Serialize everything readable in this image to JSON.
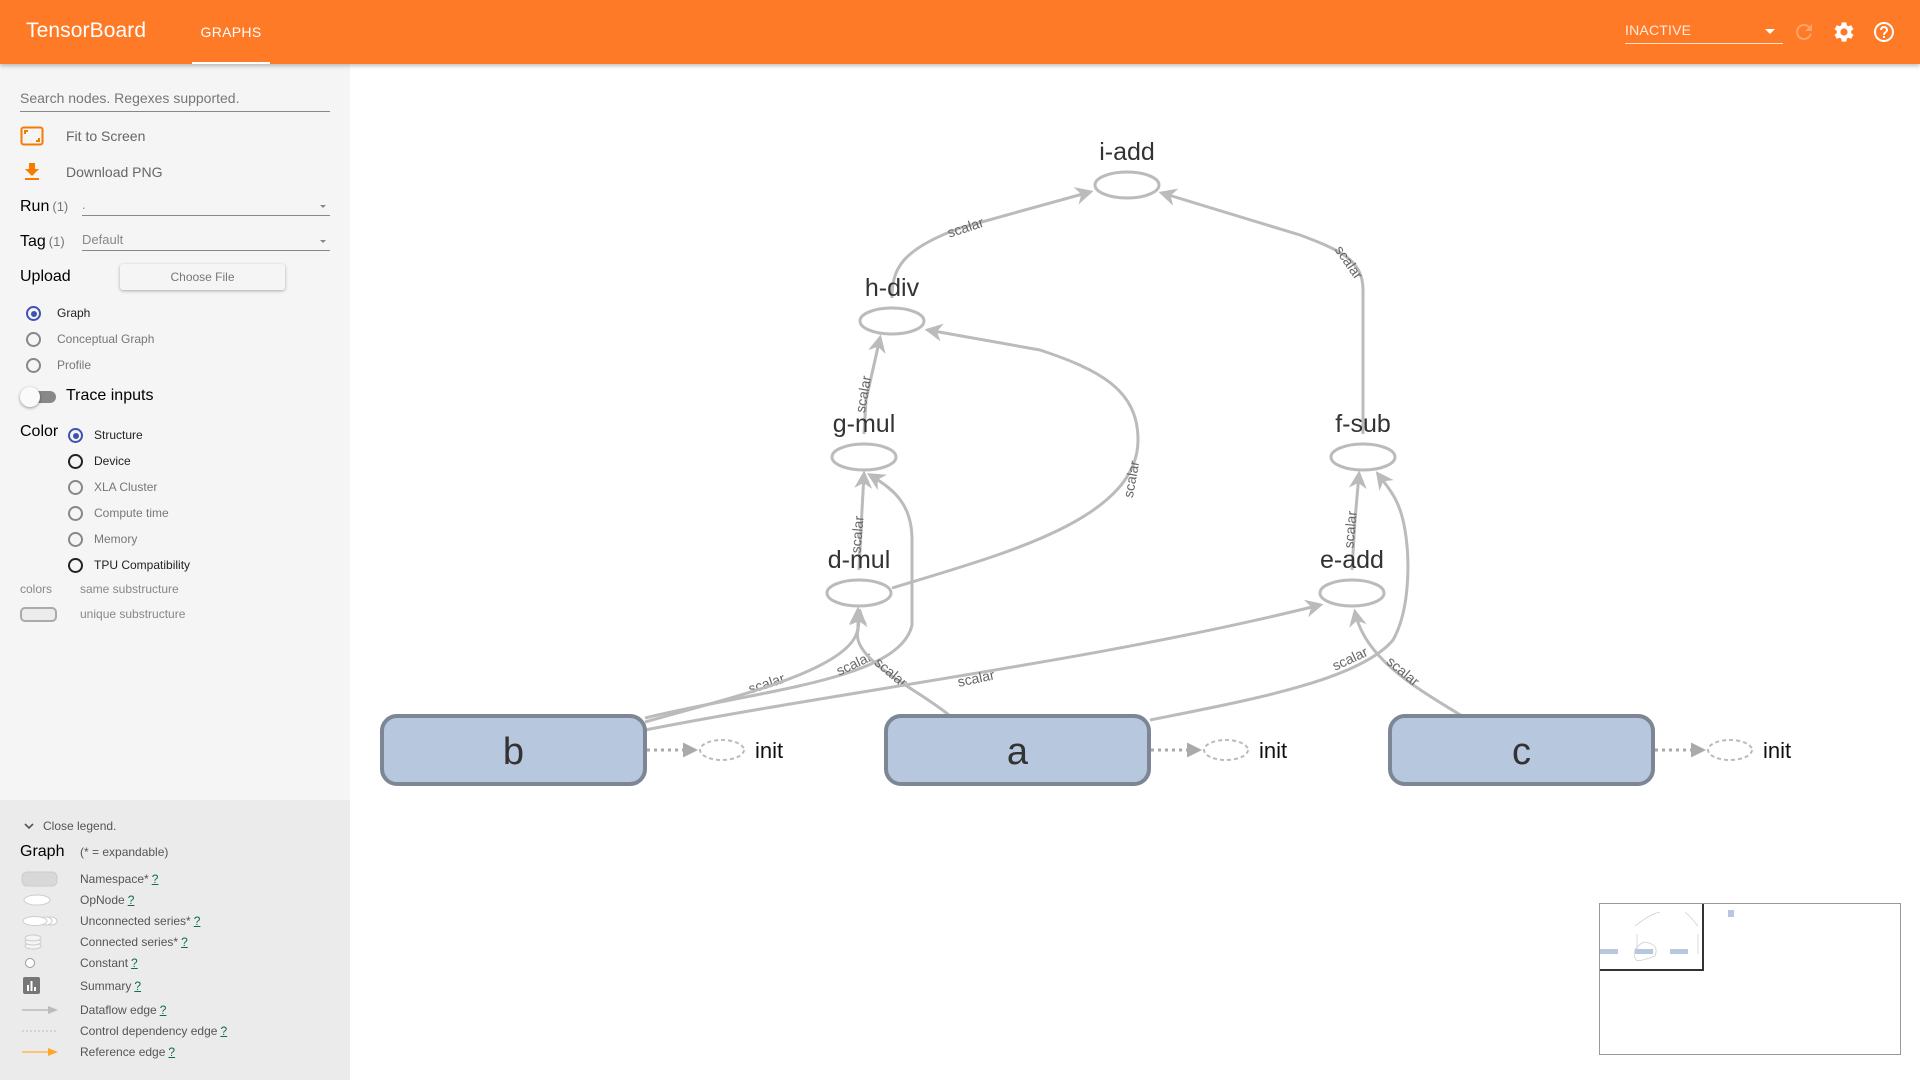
{
  "header": {
    "brand": "TensorBoard",
    "tabs": [
      {
        "label": "GRAPHS",
        "active": true
      }
    ],
    "run_status": "INACTIVE",
    "icons": [
      "refresh-icon",
      "settings-icon",
      "help-icon"
    ],
    "accent_color": "#ff7a26"
  },
  "sidebar": {
    "search_placeholder": "Search nodes. Regexes supported.",
    "actions": [
      {
        "label": "Fit to Screen",
        "icon": "fit-screen-icon"
      },
      {
        "label": "Download PNG",
        "icon": "download-icon"
      }
    ],
    "run": {
      "label": "Run",
      "count": "(1)",
      "value": "."
    },
    "tag": {
      "label": "Tag",
      "count": "(1)",
      "value": "Default"
    },
    "upload": {
      "label": "Upload",
      "button": "Choose File"
    },
    "graph_types": [
      {
        "label": "Graph",
        "selected": true
      },
      {
        "label": "Conceptual Graph",
        "selected": false
      },
      {
        "label": "Profile",
        "selected": false
      }
    ],
    "trace_inputs": {
      "label": "Trace inputs",
      "enabled": false
    },
    "color": {
      "label": "Color",
      "options": [
        {
          "label": "Structure",
          "selected": true
        },
        {
          "label": "Device",
          "selected": false
        },
        {
          "label": "XLA Cluster",
          "selected": false
        },
        {
          "label": "Compute time",
          "selected": false
        },
        {
          "label": "Memory",
          "selected": false
        },
        {
          "label": "TPU Compatibility",
          "selected": false
        }
      ]
    },
    "colors_legend": {
      "label": "colors",
      "same": "same substructure",
      "unique": "unique substructure"
    }
  },
  "legend": {
    "close": "Close legend.",
    "title": "Graph",
    "subtitle": "(* = expandable)",
    "items": [
      {
        "label": "Namespace*",
        "help": "?"
      },
      {
        "label": "OpNode",
        "help": "?"
      },
      {
        "label": "Unconnected series*",
        "help": "?"
      },
      {
        "label": "Connected series*",
        "help": "?"
      },
      {
        "label": "Constant",
        "help": "?"
      },
      {
        "label": "Summary",
        "help": "?"
      },
      {
        "label": "Dataflow edge",
        "help": "?"
      },
      {
        "label": "Control dependency edge",
        "help": "?"
      },
      {
        "label": "Reference edge",
        "help": "?"
      }
    ]
  },
  "graph": {
    "op_nodes": [
      {
        "id": "i-add",
        "label": "i-add"
      },
      {
        "id": "h-div",
        "label": "h-div"
      },
      {
        "id": "g-mul",
        "label": "g-mul"
      },
      {
        "id": "f-sub",
        "label": "f-sub"
      },
      {
        "id": "d-mul",
        "label": "d-mul"
      },
      {
        "id": "e-add",
        "label": "e-add"
      }
    ],
    "namespace_nodes": [
      {
        "id": "b",
        "label": "b",
        "aux": "init"
      },
      {
        "id": "a",
        "label": "a",
        "aux": "init"
      },
      {
        "id": "c",
        "label": "c",
        "aux": "init"
      }
    ],
    "edge_label": "scalar",
    "edges": [
      {
        "from": "h-div",
        "to": "i-add",
        "label": "scalar"
      },
      {
        "from": "f-sub",
        "to": "i-add",
        "label": "scalar"
      },
      {
        "from": "g-mul",
        "to": "h-div",
        "label": "scalar"
      },
      {
        "from": "d-mul",
        "to": "h-div",
        "label": "scalar"
      },
      {
        "from": "d-mul",
        "to": "g-mul",
        "label": "scalar"
      },
      {
        "from": "b",
        "to": "g-mul",
        "label": "scalar"
      },
      {
        "from": "b",
        "to": "d-mul",
        "label": "scalar"
      },
      {
        "from": "a",
        "to": "d-mul",
        "label": "scalar"
      },
      {
        "from": "b",
        "to": "e-add",
        "label": "scalar"
      },
      {
        "from": "e-add",
        "to": "f-sub",
        "label": "scalar"
      },
      {
        "from": "a",
        "to": "f-sub",
        "label": "scalar"
      },
      {
        "from": "c",
        "to": "e-add",
        "label": "scalar"
      }
    ],
    "node_fill": "#b7c7dd",
    "node_stroke": "#7d8694",
    "edge_color": "#bbbbbb"
  }
}
